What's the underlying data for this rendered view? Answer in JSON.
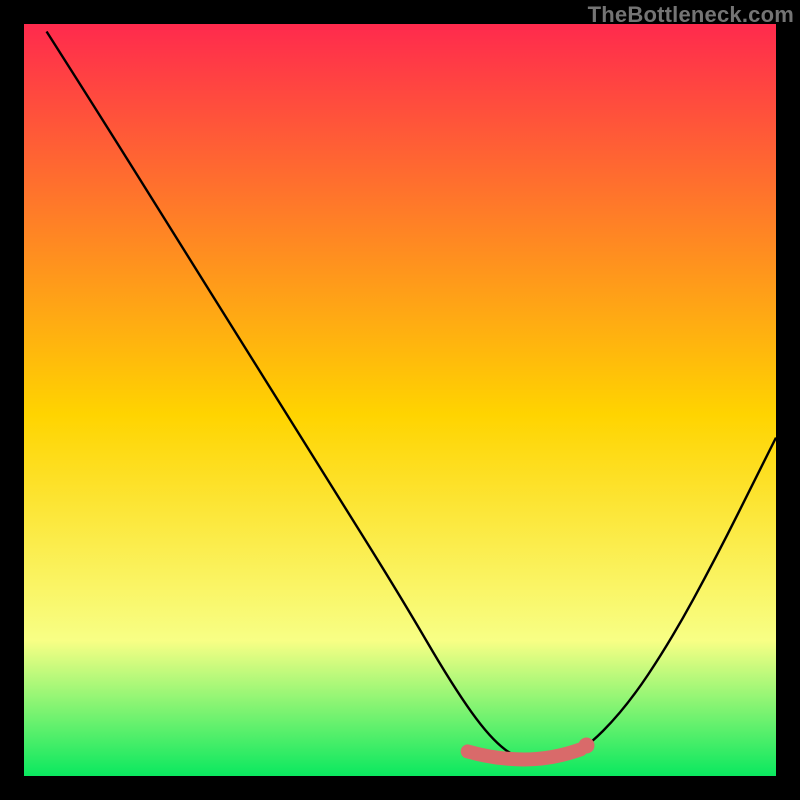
{
  "watermark": "TheBottleneck.com",
  "colors": {
    "grad_top": "#ff2a4d",
    "grad_mid": "#ffd400",
    "grad_low": "#f8ff85",
    "grad_bottom": "#0ae85f",
    "curve": "#000000",
    "marker_fill": "#d96a6a",
    "marker_stroke": "#c85a5a",
    "frame": "#000000"
  },
  "chart_data": {
    "type": "line",
    "title": "",
    "xlabel": "",
    "ylabel": "",
    "xlim": [
      0,
      100
    ],
    "ylim": [
      0,
      100
    ],
    "grid": false,
    "legend": false,
    "series": [
      {
        "name": "bottleneck-curve",
        "x": [
          3,
          10,
          20,
          30,
          40,
          50,
          57,
          62,
          66,
          70,
          74,
          80,
          86,
          92,
          98,
          100
        ],
        "y": [
          99,
          88,
          72,
          56,
          40,
          24,
          12,
          5,
          2,
          2,
          3,
          9,
          18,
          29,
          41,
          45
        ]
      }
    ],
    "optimal_range": {
      "x_start": 59,
      "x_end": 74,
      "y": 3
    }
  }
}
